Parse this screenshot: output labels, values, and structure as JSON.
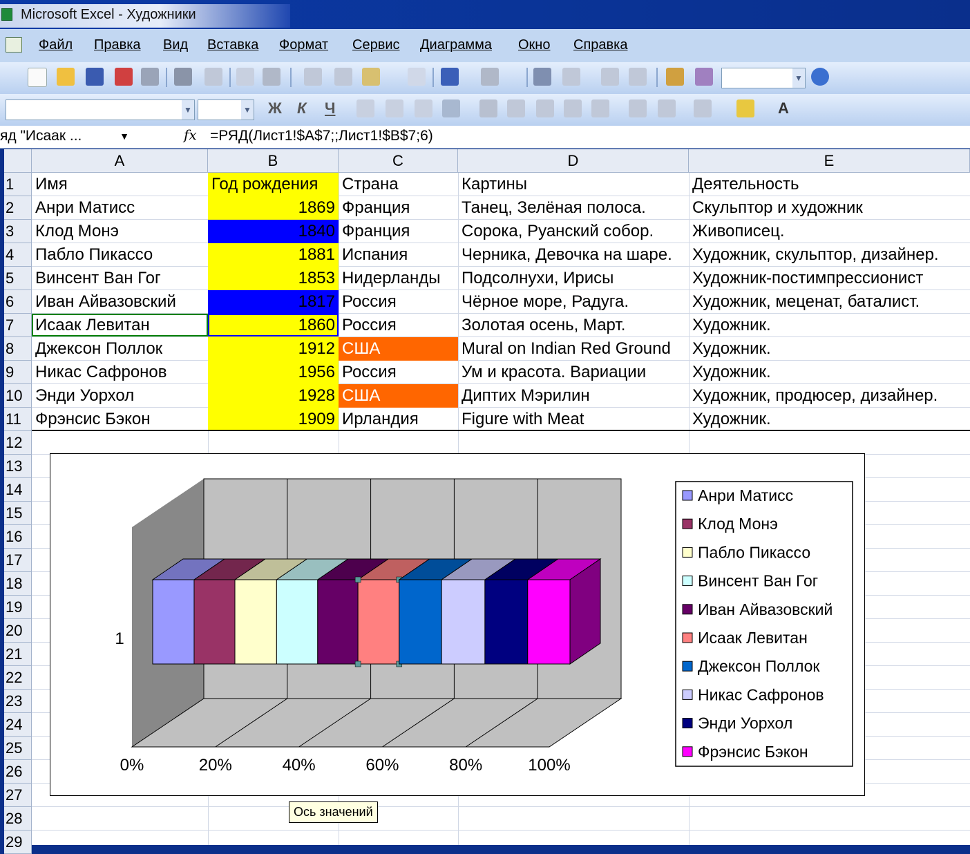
{
  "window": {
    "title": "Microsoft Excel - Художники"
  },
  "menu": [
    "Файл",
    "Правка",
    "Вид",
    "Вставка",
    "Формат",
    "Сервис",
    "Диаграмма",
    "Окно",
    "Справка"
  ],
  "formula_bar": {
    "name_box": "яд \"Исаак ...",
    "fx": "fx",
    "formula": "=РЯД(Лист1!$A$7;;Лист1!$B$7;6)"
  },
  "columns": [
    "A",
    "B",
    "C",
    "D",
    "E"
  ],
  "row_numbers": [
    "1",
    "2",
    "3",
    "4",
    "5",
    "6",
    "7",
    "8",
    "9",
    "10",
    "11",
    "12",
    "13",
    "14",
    "15",
    "16",
    "17",
    "18",
    "19",
    "20",
    "21",
    "22",
    "23",
    "24",
    "25",
    "26",
    "27",
    "28",
    "29"
  ],
  "table": {
    "rows": [
      [
        "Имя",
        "Год рождения",
        "Страна",
        "Картины",
        "Деятельность"
      ],
      [
        "Анри Матисс",
        "1869",
        "Франция",
        "Танец, Зелёная полоса.",
        "Скульптор и художник"
      ],
      [
        "Клод Монэ",
        "1840",
        "Франция",
        "Сорока, Руанский собор.",
        "Живописец."
      ],
      [
        "Пабло Пикассо",
        "1881",
        "Испания",
        "Черника, Девочка на шаре.",
        "Художник, скульптор, дизайнер."
      ],
      [
        "Винсент Ван Гог",
        "1853",
        "Нидерланды",
        "Подсолнухи, Ирисы",
        "Художник-постимпрессионист"
      ],
      [
        "Иван Айвазовский",
        "1817",
        "Россия",
        "Чёрное море, Радуга.",
        "Художник, меценат, баталист."
      ],
      [
        "Исаак Левитан",
        "1860",
        "Россия",
        "Золотая осень, Март.",
        "Художник."
      ],
      [
        "Джексон Поллок",
        "1912",
        "США",
        "Mural on Indian Red Ground",
        "Художник."
      ],
      [
        "Никас Сафронов",
        "1956",
        "Россия",
        "Ум и красота. Вариации",
        "Художник."
      ],
      [
        "Энди Уорхол",
        "1928",
        "США",
        "Диптих Мэрилин",
        "Художник, продюсер, дизайнер."
      ],
      [
        "Фрэнсис Бэкон",
        "1909",
        "Ирландия",
        "Figure with Meat",
        "Художник."
      ]
    ],
    "b_fill": [
      "#ffff00",
      "#ffff00",
      "#0000ff",
      "#ffff00",
      "#ffff00",
      "#0000ff",
      "#ffff00",
      "#ffff00",
      "#ffff00",
      "#ffff00",
      "#ffff00"
    ],
    "c_fill": [
      "",
      "",
      "",
      "",
      "",
      "",
      "",
      "#ff6600",
      "",
      "#ff6600",
      ""
    ],
    "c_text_color": [
      "",
      "",
      "",
      "",
      "",
      "",
      "",
      "#ffffff",
      "",
      "#ffffff",
      ""
    ]
  },
  "chart_data": {
    "type": "bar",
    "orientation": "horizontal-100%-stacked-3d",
    "categories": [
      "1"
    ],
    "series": [
      {
        "name": "Анри Матисс",
        "values": [
          1869
        ],
        "color": "#9999ff"
      },
      {
        "name": "Клод Монэ",
        "values": [
          1840
        ],
        "color": "#993366"
      },
      {
        "name": "Пабло Пикассо",
        "values": [
          1881
        ],
        "color": "#ffffcc"
      },
      {
        "name": "Винсент Ван Гог",
        "values": [
          1853
        ],
        "color": "#ccffff"
      },
      {
        "name": "Иван Айвазовский",
        "values": [
          1817
        ],
        "color": "#660066"
      },
      {
        "name": "Исаак Левитан",
        "values": [
          1860
        ],
        "color": "#ff8080"
      },
      {
        "name": "Джексон Поллок",
        "values": [
          1912
        ],
        "color": "#0066cc"
      },
      {
        "name": "Никас Сафронов",
        "values": [
          1956
        ],
        "color": "#ccccff"
      },
      {
        "name": "Энди Уорхол",
        "values": [
          1928
        ],
        "color": "#000080"
      },
      {
        "name": "Фрэнсис Бэкон",
        "values": [
          1909
        ],
        "color": "#ff00ff"
      }
    ],
    "x_ticks": [
      "0%",
      "20%",
      "40%",
      "60%",
      "80%",
      "100%"
    ],
    "xlim": [
      0,
      100
    ],
    "legend": "right",
    "grid": true
  },
  "tooltip": "Ось значений"
}
